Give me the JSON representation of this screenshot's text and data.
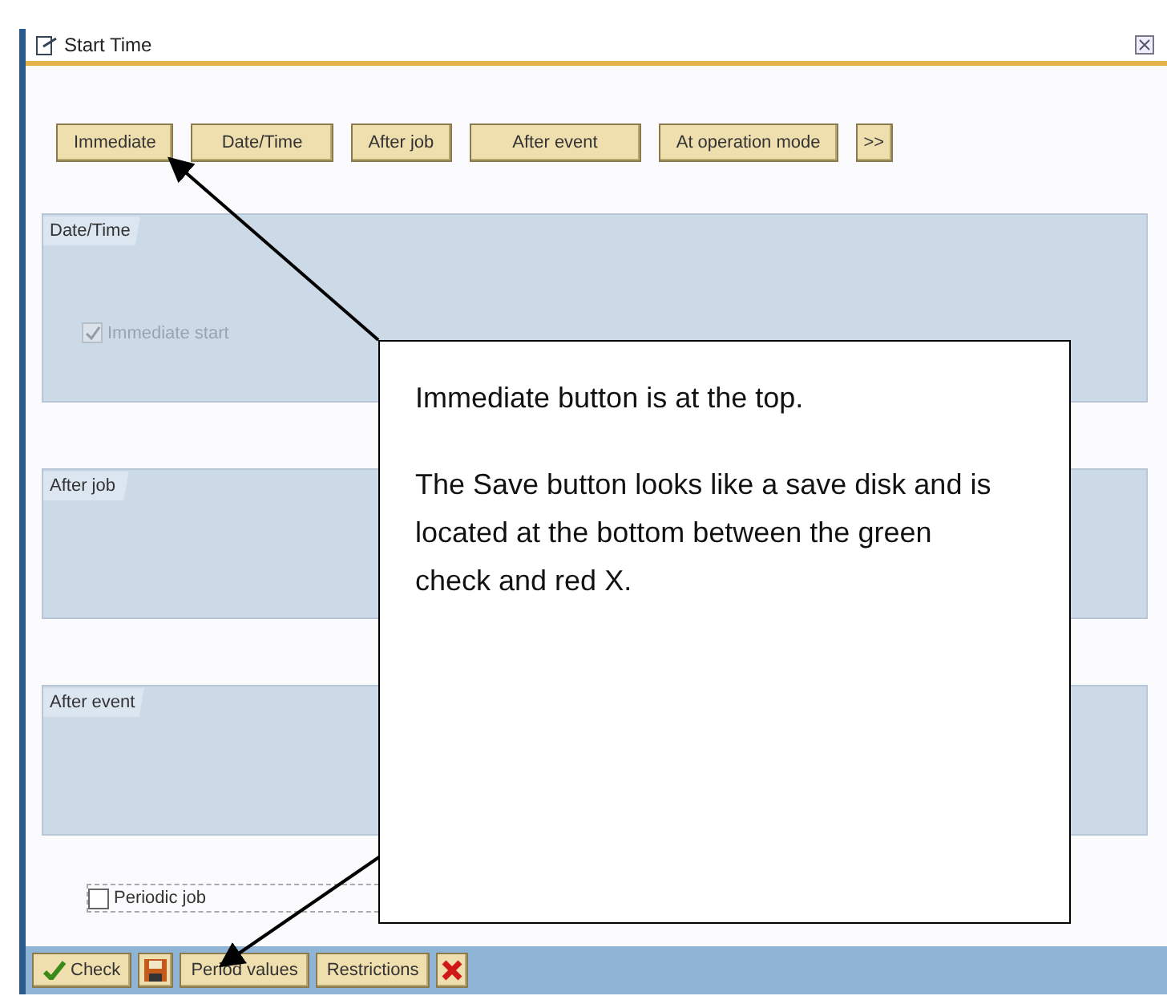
{
  "window": {
    "title": "Start Time"
  },
  "start_buttons": [
    {
      "label": "Immediate"
    },
    {
      "label": "Date/Time"
    },
    {
      "label": "After job"
    },
    {
      "label": "After event"
    },
    {
      "label": "At operation mode"
    },
    {
      "label": ">>"
    }
  ],
  "groups": [
    {
      "title": "Date/Time",
      "checkbox": {
        "label": "Immediate start",
        "checked": true,
        "disabled": true
      }
    },
    {
      "title": "After job"
    },
    {
      "title": "After event"
    }
  ],
  "periodic_job": {
    "label": "Periodic job",
    "checked": false
  },
  "toolbar": [
    {
      "kind": "check",
      "label": "Check"
    },
    {
      "kind": "save"
    },
    {
      "kind": "text",
      "label": "Period values"
    },
    {
      "kind": "text",
      "label": "Restrictions"
    },
    {
      "kind": "cancel"
    }
  ],
  "callout": {
    "paragraphs": [
      "Immediate button is at the top.",
      "The Save button looks like a save disk and is located at the bottom between the green check and red X."
    ]
  }
}
